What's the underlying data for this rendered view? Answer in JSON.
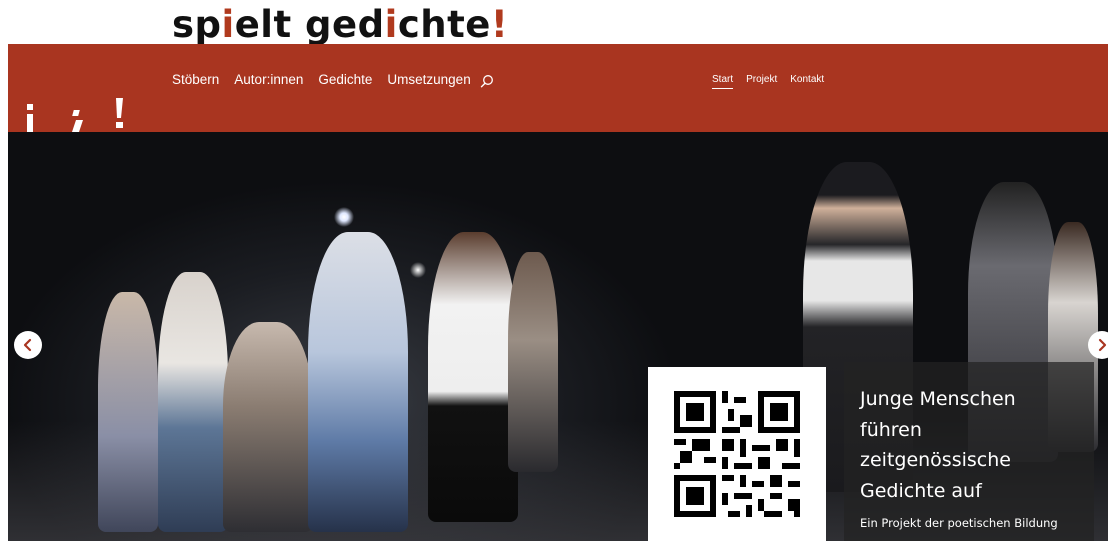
{
  "brand": {
    "logo_part1": "sp",
    "logo_accent1": "i",
    "logo_part2": "elt ged",
    "logo_accent2": "i",
    "logo_part3": "chte",
    "logo_accent3": "!"
  },
  "main_nav": {
    "items": [
      "Stöbern",
      "Autor:innen",
      "Gedichte",
      "Umsetzungen"
    ],
    "search_icon": "search-icon"
  },
  "meta_nav": {
    "items": [
      "Start",
      "Projekt",
      "Kontakt"
    ],
    "active": "Start"
  },
  "hero": {
    "headline": "Junge Menschen führen zeitgenössische Gedichte auf",
    "subline": "Ein Projekt der poetischen Bildung",
    "prev_icon": "chevron-left-icon",
    "next_icon": "chevron-right-icon",
    "qr_icon": "qr-code-icon"
  },
  "colors": {
    "accent": "#a93520",
    "logo_accent": "#b03a1e"
  }
}
